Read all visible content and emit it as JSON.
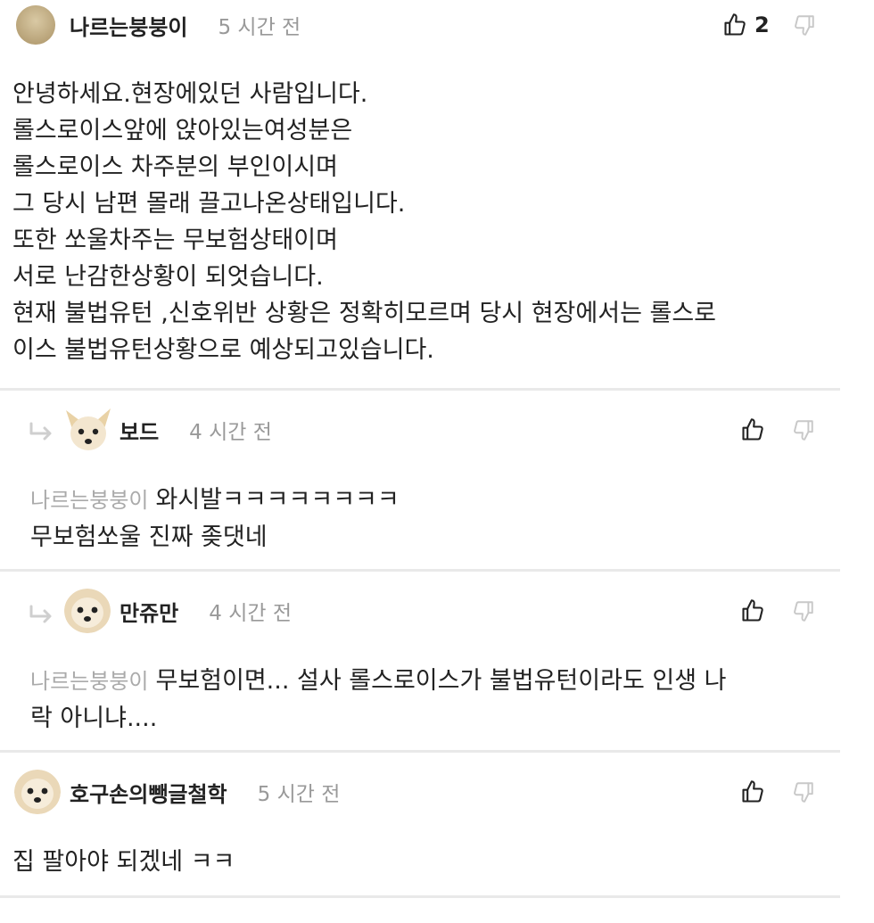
{
  "comments": [
    {
      "author": "나르는붕붕이",
      "time": "5 시간 전",
      "likes": "2",
      "lines": [
        "안녕하세요.현장에있던 사람입니다.",
        "롤스로이스앞에 앉아있는여성분은",
        "롤스로이스 차주분의 부인이시며",
        "그 당시 남편 몰래 끌고나온상태입니다.",
        "또한 쏘울차주는 무보험상태이며",
        "서로 난감한상황이 되엇습니다.",
        "현재 불법유턴 ,신호위반 상황은 정확히모르며 당시 현장에서는 롤스로",
        "이스 불법유턴상황으로 예상되고있습니다."
      ]
    },
    {
      "author": "보드",
      "time": "4 시간 전",
      "mention": "나르는붕붕이",
      "line1": "와시발ㅋㅋㅋㅋㅋㅋㅋㅋ",
      "line2": "무보험쏘울 진짜 좆댓네"
    },
    {
      "author": "만쥬만",
      "time": "4 시간 전",
      "mention": "나르는붕붕이",
      "line1": "무보험이면... 설사 롤스로이스가 불법유턴이라도 인생 나",
      "line2": "락 아니냐...."
    },
    {
      "author": "호구손의뺑글철학",
      "time": "5 시간 전",
      "line1": "집 팔아야 되겠네 ㅋㅋ"
    }
  ],
  "colors": {
    "divider": "#e9e9e9",
    "muted": "#999999",
    "mention": "#aaaaaa",
    "text": "#222222"
  },
  "icons": [
    "thumbs-up-icon",
    "thumbs-down-icon",
    "reply-arrow-icon"
  ]
}
